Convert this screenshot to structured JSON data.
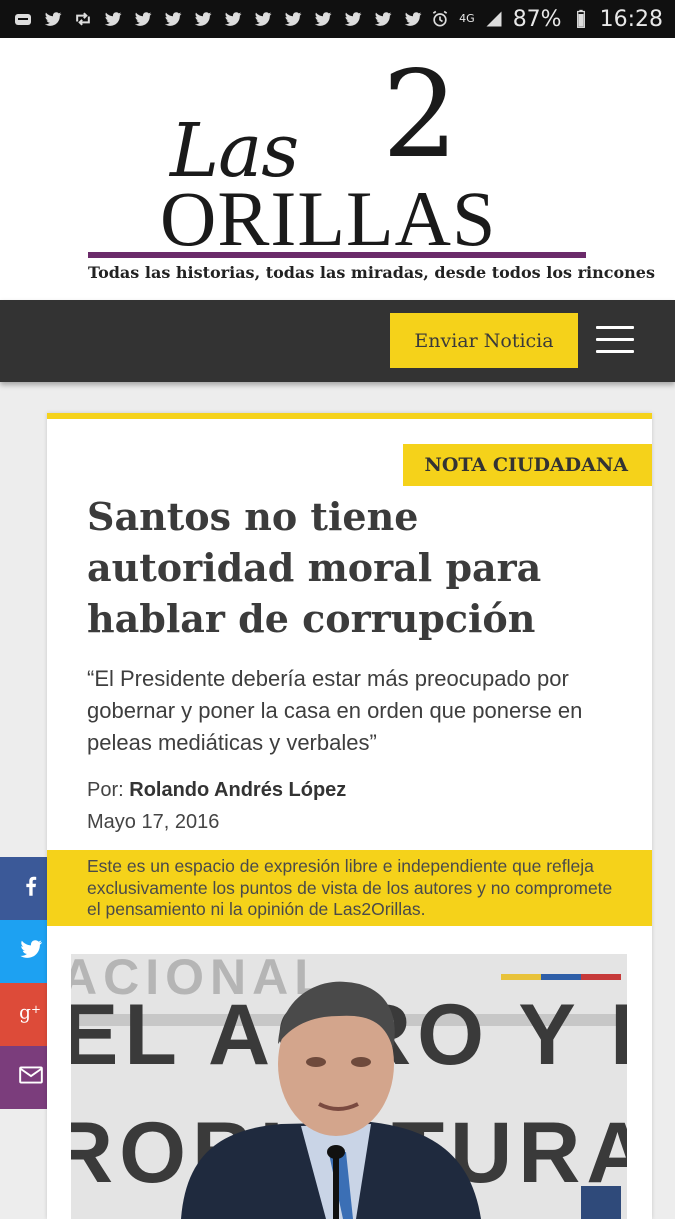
{
  "status_bar": {
    "notification_icons": [
      "app-icon",
      "twitter-icon",
      "retweet-icon",
      "twitter-icon",
      "twitter-icon",
      "twitter-icon",
      "twitter-icon",
      "twitter-icon",
      "twitter-icon",
      "twitter-icon",
      "twitter-icon",
      "twitter-icon",
      "twitter-icon",
      "twitter-icon"
    ],
    "network": "4G",
    "battery": "87%",
    "time": "16:28"
  },
  "header": {
    "logo_las": "Las",
    "logo_two": "2",
    "logo_orillas": "ORILLAS",
    "tagline": "Todas las historias, todas las miradas, desde todos los rincones"
  },
  "nav": {
    "send_label": "Enviar Noticia",
    "menu_icon": "hamburger-menu-icon"
  },
  "article": {
    "tag": "NOTA CIUDADANA",
    "title": "Santos no tiene autoridad moral para hablar de corrupción",
    "subtitle": "“El Presidente debería estar más preocupado por gobernar y poner la casa en orden que ponerse en peleas mediáticas y verbales”",
    "by_prefix": "Por:",
    "author": "Rolando Andrés López",
    "date": "Mayo 17, 2016",
    "disclaimer": "Este es un espacio de expresión libre e independiente que refleja exclusivamente los puntos de vista de los autores y no compromete el pensamiento ni la opinión de Las2Orillas.",
    "photo_backdrop_text": "EL AGRO Y EL"
  },
  "share": [
    {
      "name": "facebook",
      "icon": "facebook-icon",
      "color": "#3b5998"
    },
    {
      "name": "twitter",
      "icon": "twitter-icon",
      "color": "#1da1f2"
    },
    {
      "name": "google-plus",
      "icon": "google-plus-icon",
      "color": "#dd4b39"
    },
    {
      "name": "email",
      "icon": "mail-icon",
      "color": "#7b3d7c"
    }
  ],
  "colors": {
    "accent_yellow": "#f5d21a",
    "brand_purple": "#6b2b6a",
    "navbar": "#333333"
  }
}
